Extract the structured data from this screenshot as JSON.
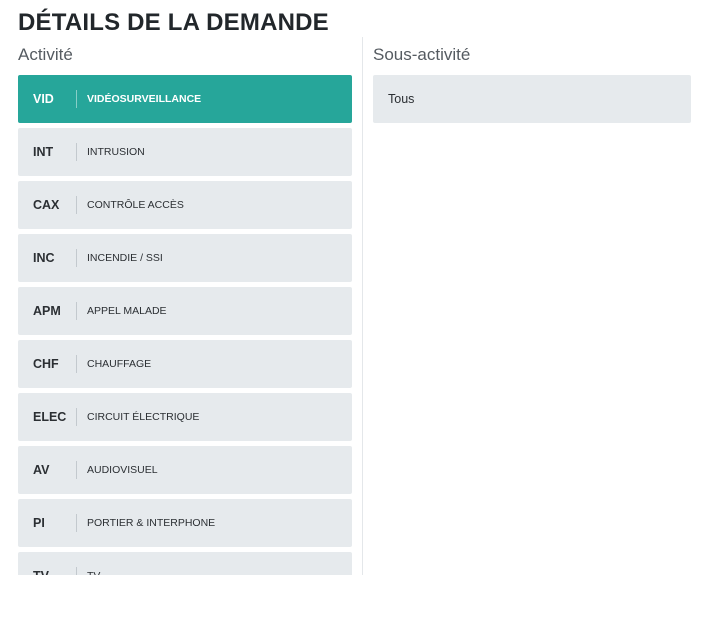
{
  "header": {
    "title": "DÉTAILS DE LA DEMANDE"
  },
  "activity": {
    "title": "Activité",
    "selected_index": 0,
    "items": [
      {
        "code": "VID",
        "label": "VIDÉOSURVEILLANCE"
      },
      {
        "code": "INT",
        "label": "INTRUSION"
      },
      {
        "code": "CAX",
        "label": "CONTRÔLE ACCÈS"
      },
      {
        "code": "INC",
        "label": "INCENDIE / SSI"
      },
      {
        "code": "APM",
        "label": "APPEL MALADE"
      },
      {
        "code": "CHF",
        "label": "CHAUFFAGE"
      },
      {
        "code": "ELEC",
        "label": "CIRCUIT ÉLECTRIQUE"
      },
      {
        "code": "AV",
        "label": "AUDIOVISUEL"
      },
      {
        "code": "PI",
        "label": "PORTIER & INTERPHONE"
      },
      {
        "code": "TV",
        "label": "TV"
      }
    ]
  },
  "subactivity": {
    "title": "Sous-activité",
    "items": [
      {
        "label": "Tous"
      }
    ]
  },
  "colors": {
    "accent": "#26a69a",
    "item_bg": "#e6eaed"
  }
}
